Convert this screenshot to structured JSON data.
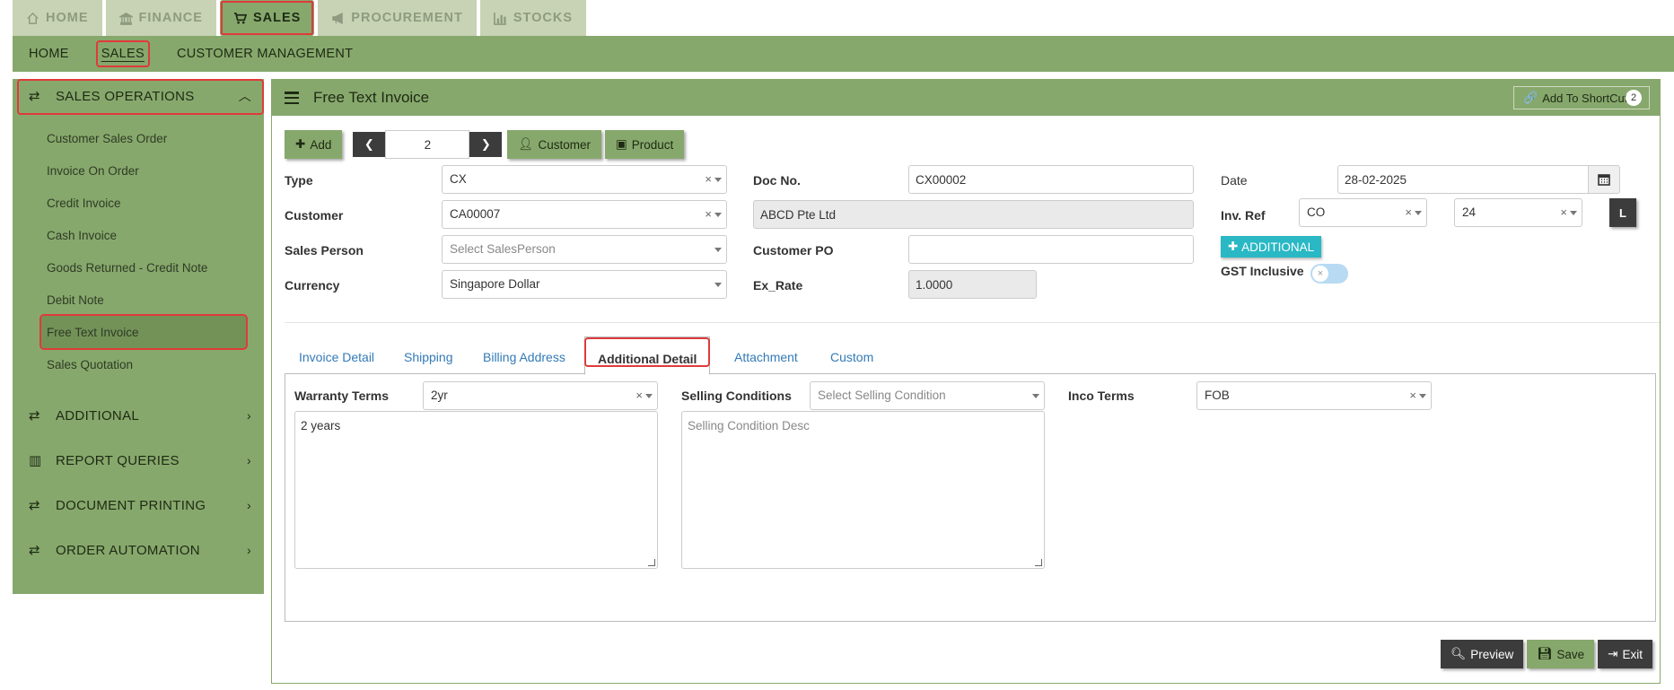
{
  "top_tabs": [
    {
      "label": "HOME",
      "icon": "home-icon"
    },
    {
      "label": "FINANCE",
      "icon": "bank-icon"
    },
    {
      "label": "SALES",
      "icon": "cart-icon"
    },
    {
      "label": "PROCUREMENT",
      "icon": "bullhorn-icon"
    },
    {
      "label": "STOCKS",
      "icon": "bar-chart-icon"
    }
  ],
  "subnav": [
    "HOME",
    "SALES",
    "CUSTOMER MANAGEMENT"
  ],
  "sidebar": {
    "group_main": "SALES OPERATIONS",
    "items": [
      "Customer Sales Order",
      "Invoice On Order",
      "Credit Invoice",
      "Cash Invoice",
      "Goods Returned - Credit Note",
      "Debit Note",
      "Free Text Invoice",
      "Sales Quotation"
    ],
    "groups": [
      "ADDITIONAL",
      "REPORT QUERIES",
      "DOCUMENT PRINTING",
      "ORDER AUTOMATION"
    ]
  },
  "panel": {
    "title": "Free Text Invoice",
    "shortcut_label": "Add To ShortCut",
    "shortcut_count": "2"
  },
  "toolbar": {
    "add_label": "Add",
    "record_number": "2",
    "customer_label": "Customer",
    "product_label": "Product"
  },
  "form": {
    "type_label": "Type",
    "type_value": "CX",
    "customer_label": "Customer",
    "customer_value": "CA00007",
    "salesperson_label": "Sales Person",
    "salesperson_placeholder": "Select SalesPerson",
    "currency_label": "Currency",
    "currency_value": "Singapore Dollar",
    "docno_label": "Doc No.",
    "docno_value": "CX00002",
    "customer_name": "ABCD Pte Ltd",
    "customer_po_label": "Customer PO",
    "customer_po_value": "",
    "exrate_label": "Ex_Rate",
    "exrate_value": "1.0000",
    "date_label": "Date",
    "date_value": "28-02-2025",
    "invref_label": "Inv. Ref",
    "invref_prefix": "CO",
    "invref_number": "24",
    "l_button": "L",
    "additional_button": "ADDITIONAL",
    "gst_label": "GST Inclusive"
  },
  "tabs": [
    "Invoice Detail",
    "Shipping",
    "Billing Address",
    "Additional Detail",
    "Attachment",
    "Custom"
  ],
  "additional": {
    "warranty_label": "Warranty Terms",
    "warranty_value": "2yr",
    "warranty_desc": "2 years",
    "selling_label": "Selling Conditions",
    "selling_placeholder": "Select Selling Condition",
    "selling_desc_placeholder": "Selling Condition Desc",
    "inco_label": "Inco Terms",
    "inco_value": "FOB"
  },
  "actions": {
    "preview": "Preview",
    "save": "Save",
    "exit": "Exit"
  },
  "colors": {
    "theme_green": "#87a86c",
    "highlight_red": "#e03a3a",
    "dark_button": "#3c3c3c",
    "cyan_button": "#29b8c4"
  }
}
